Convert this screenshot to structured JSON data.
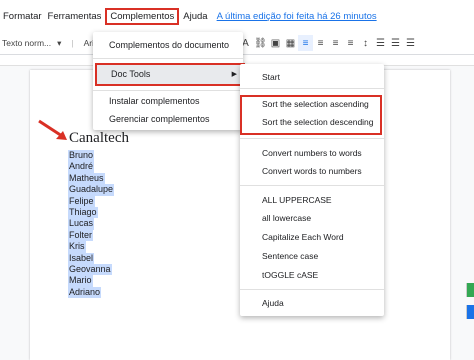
{
  "menubar": {
    "items": [
      "Formatar",
      "Ferramentas",
      "Complementos",
      "Ajuda"
    ],
    "last_edit": "A última edição foi feita há 26 minutos"
  },
  "toolbar": {
    "style_select": "Texto norm...",
    "font_select": "Arial"
  },
  "document": {
    "title": "Canaltech",
    "names": [
      "Bruno",
      "André",
      "Matheus",
      "Guadalupe",
      "Felipe",
      "Thiago",
      "Lucas",
      "Folter",
      "Kris",
      "Isabel",
      "Geovanna",
      "Mario",
      "Adriano"
    ]
  },
  "complementos_menu": {
    "items": [
      "Complementos do documento",
      "Doc Tools",
      "Instalar complementos",
      "Gerenciar complementos"
    ]
  },
  "doc_tools_submenu": {
    "items": [
      "Start",
      "Sort the selection ascending",
      "Sort the selection descending",
      "Convert numbers to words",
      "Convert words to numbers",
      "ALL UPPERCASE",
      "all lowercase",
      "Capitalize Each Word",
      "Sentence case",
      "tOGGLE cASE",
      "Ajuda"
    ]
  },
  "colors": {
    "highlight_box": "#d93025",
    "selection": "#c6dafc",
    "link": "#1a73e8"
  }
}
